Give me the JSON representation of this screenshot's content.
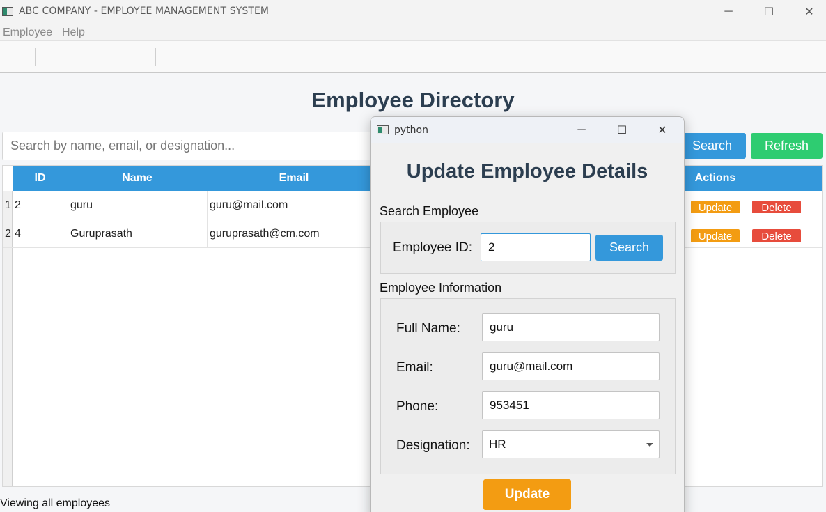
{
  "window": {
    "title": "ABC COMPANY - EMPLOYEE MANAGEMENT SYSTEM",
    "minimize": "─",
    "maximize": "☐",
    "close": "✕"
  },
  "menu": {
    "items": [
      "Employee",
      "Help"
    ]
  },
  "page_title": "Employee Directory",
  "search": {
    "placeholder": "Search by name, email, or designation...",
    "value": ""
  },
  "buttons": {
    "search": "Search",
    "refresh": "Refresh"
  },
  "table": {
    "headers": {
      "id": "ID",
      "name": "Name",
      "email": "Email",
      "actions": "Actions"
    },
    "rows": [
      {
        "num": "1",
        "id": "2",
        "name": "guru",
        "email": "guru@mail.com",
        "update": "Update",
        "delete": "Delete"
      },
      {
        "num": "2",
        "id": "4",
        "name": "Guruprasath",
        "email": "guruprasath@cm.com",
        "update": "Update",
        "delete": "Delete"
      }
    ]
  },
  "status": "Viewing all employees",
  "dialog": {
    "title": "python",
    "heading": "Update Employee Details",
    "search_group": "Search Employee",
    "employee_id_label": "Employee ID:",
    "employee_id_value": "2",
    "search_button": "Search",
    "info_group": "Employee Information",
    "full_name_label": "Full Name:",
    "full_name": "guru",
    "email_label": "Email:",
    "email": "guru@mail.com",
    "phone_label": "Phone:",
    "phone": "953451",
    "designation_label": "Designation:",
    "designation": "HR",
    "update_button": "Update"
  },
  "colors": {
    "accent_blue": "#3498db",
    "refresh_green": "#2ecc71",
    "update_orange": "#f39c12",
    "delete_red": "#e74c3c",
    "heading": "#2c3e50"
  }
}
